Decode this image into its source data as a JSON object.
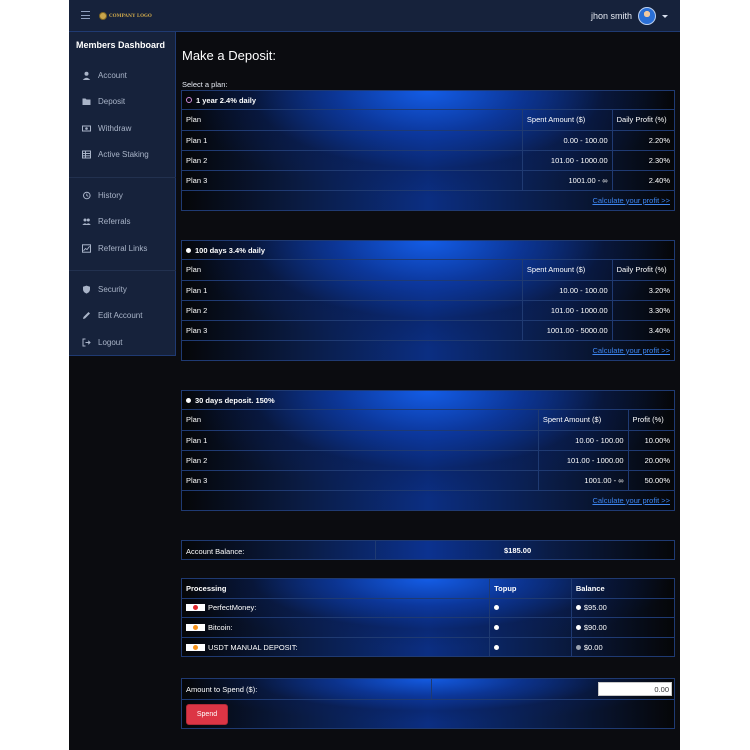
{
  "header": {
    "logo_text": "COMPANY LOGO",
    "user_name": "jhon smith"
  },
  "sidebar": {
    "title": "Members Dashboard",
    "items": [
      {
        "label": "Account",
        "icon": "user-icon"
      },
      {
        "label": "Deposit",
        "icon": "folder-icon"
      },
      {
        "label": "Withdraw",
        "icon": "money-icon"
      },
      {
        "label": "Active Staking",
        "icon": "table-icon"
      },
      {
        "label": "History",
        "icon": "history-icon"
      },
      {
        "label": "Referrals",
        "icon": "users-icon"
      },
      {
        "label": "Referral Links",
        "icon": "chart-icon"
      },
      {
        "label": "Security",
        "icon": "shield-icon"
      },
      {
        "label": "Edit Account",
        "icon": "pencil-icon"
      },
      {
        "label": "Logout",
        "icon": "logout-icon"
      }
    ]
  },
  "main": {
    "title": "Make a Deposit:",
    "select_label": "Select a plan:",
    "calc_link": "Calculate your profit >>",
    "plans": [
      {
        "name": "1 year 2.4% daily",
        "selected": true,
        "headers": [
          "Plan",
          "Spent Amount ($)",
          "Daily Profit (%)"
        ],
        "rows": [
          [
            "Plan 1",
            "0.00 - 100.00",
            "2.20%"
          ],
          [
            "Plan 2",
            "101.00 - 1000.00",
            "2.30%"
          ],
          [
            "Plan 3",
            "1001.00 - ∞",
            "2.40%"
          ]
        ]
      },
      {
        "name": "100 days 3.4% daily",
        "selected": false,
        "headers": [
          "Plan",
          "Spent Amount ($)",
          "Daily Profit (%)"
        ],
        "rows": [
          [
            "Plan 1",
            "10.00 - 100.00",
            "3.20%"
          ],
          [
            "Plan 2",
            "101.00 - 1000.00",
            "3.30%"
          ],
          [
            "Plan 3",
            "1001.00 - 5000.00",
            "3.40%"
          ]
        ]
      },
      {
        "name": "30 days deposit. 150%",
        "selected": false,
        "headers": [
          "Plan",
          "Spent Amount ($)",
          "Profit (%)"
        ],
        "rows": [
          [
            "Plan 1",
            "10.00 - 100.00",
            "10.00%"
          ],
          [
            "Plan 2",
            "101.00 - 1000.00",
            "20.00%"
          ],
          [
            "Plan 3",
            "1001.00 - ∞",
            "50.00%"
          ]
        ]
      }
    ],
    "balance": {
      "label": "Account Balance:",
      "value": "$185.00"
    },
    "processing": {
      "headers": [
        "Processing",
        "Topup",
        "Balance"
      ],
      "rows": [
        {
          "name": "PerfectMoney:",
          "balance": "$95.00",
          "logo_color": "#e0262c"
        },
        {
          "name": "Bitcoin:",
          "balance": "$90.00",
          "logo_color": "#f7931a"
        },
        {
          "name": "USDT MANUAL DEPOSIT:",
          "balance": "$0.00",
          "logo_color": "#f7931a"
        }
      ]
    },
    "spend": {
      "label": "Amount to Spend ($):",
      "value": "0.00",
      "button": "Spend"
    }
  },
  "colors": {
    "accent": "#3e86f0",
    "button": "#dc3545",
    "panel": "#16223b",
    "border": "#1f3a72"
  }
}
